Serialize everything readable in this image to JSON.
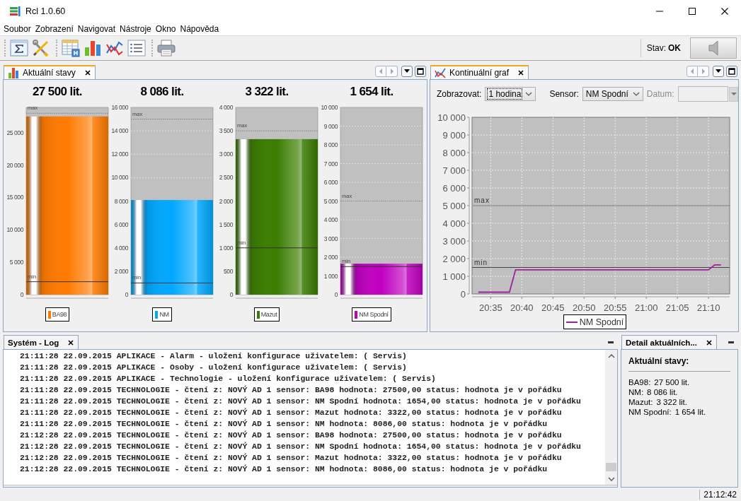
{
  "window": {
    "title": "Rcl 1.0.60"
  },
  "menu": [
    "Soubor",
    "Zobrazení",
    "Navigovat",
    "Nástroje",
    "Okno",
    "Nápověda"
  ],
  "toolbar": {
    "status": "Stav: **OK**"
  },
  "panels": {
    "current_states": {
      "tab": "Aktuální stavy",
      "gauges": [
        {
          "chart_data": {
            "type": "bar",
            "title": "27 500 lit.",
            "ylim": [
              0,
              28900
            ],
            "yticks": [
              {
                "value": 0,
                "label": "0"
              },
              {
                "value": 5000,
                "label": "5 000"
              },
              {
                "value": 10000,
                "label": "10 000"
              },
              {
                "value": 15000,
                "label": "15 000"
              },
              {
                "value": 20000,
                "label": "20 000"
              },
              {
                "value": 25000,
                "label": "25 000"
              }
            ],
            "series": [
              {
                "name": "BA98",
                "color": "#ff7a00",
                "values": [
                  27500
                ]
              }
            ],
            "ref_lines": [
              {
                "axis": "y",
                "value": 28000,
                "label": "max"
              },
              {
                "axis": "y",
                "value": 2000,
                "label": "min"
              }
            ]
          }
        },
        {
          "chart_data": {
            "type": "bar",
            "title": "8 086 lit.",
            "grid": true,
            "ylim": [
              0,
              16000
            ],
            "yticks": [
              {
                "value": 0,
                "label": "0"
              },
              {
                "value": 2000,
                "label": "2 000"
              },
              {
                "value": 4000,
                "label": "4 000"
              },
              {
                "value": 6000,
                "label": "6 000"
              },
              {
                "value": 8000,
                "label": "8 000"
              },
              {
                "value": 10000,
                "label": "10 000"
              },
              {
                "value": 12000,
                "label": "12 000"
              },
              {
                "value": 14000,
                "label": "14 000"
              },
              {
                "value": 16000,
                "label": "16 000"
              }
            ],
            "series": [
              {
                "name": "NM",
                "color": "#00a8ff",
                "values": [
                  8086
                ]
              }
            ],
            "ref_lines": [
              {
                "axis": "y",
                "value": 15000,
                "label": "max"
              },
              {
                "axis": "y",
                "value": 1000,
                "label": "min"
              }
            ]
          }
        },
        {
          "chart_data": {
            "type": "bar",
            "title": "3 322 lit.",
            "ylim": [
              0,
              4000
            ],
            "yticks": [
              {
                "value": 0,
                "label": "0"
              },
              {
                "value": 500,
                "label": "500"
              },
              {
                "value": 1000,
                "label": "1 000"
              },
              {
                "value": 1500,
                "label": "1 500"
              },
              {
                "value": 2000,
                "label": "2 000"
              },
              {
                "value": 2500,
                "label": "2 500"
              },
              {
                "value": 3000,
                "label": "3 000"
              },
              {
                "value": 3500,
                "label": "3 500"
              },
              {
                "value": 4000,
                "label": "4 000"
              }
            ],
            "series": [
              {
                "name": "Mazut",
                "color": "#3a7d00",
                "values": [
                  3322
                ]
              }
            ],
            "ref_lines": [
              {
                "axis": "y",
                "value": 3500,
                "label": "max"
              },
              {
                "axis": "y",
                "value": 1000,
                "label": "min"
              }
            ]
          }
        },
        {
          "chart_data": {
            "type": "bar",
            "title": "1 654 lit.",
            "grid": true,
            "ylim": [
              0,
              10000
            ],
            "yticks": [
              {
                "value": 0,
                "label": "0"
              },
              {
                "value": 1000,
                "label": "1 000"
              },
              {
                "value": 2000,
                "label": "2 000"
              },
              {
                "value": 3000,
                "label": "3 000"
              },
              {
                "value": 4000,
                "label": "4 000"
              },
              {
                "value": 5000,
                "label": "5 000"
              },
              {
                "value": 6000,
                "label": "6 000"
              },
              {
                "value": 7000,
                "label": "7 000"
              },
              {
                "value": 8000,
                "label": "8 000"
              },
              {
                "value": 9000,
                "label": "9 000"
              },
              {
                "value": 10000,
                "label": "10 000"
              }
            ],
            "series": [
              {
                "name": "NM Spodní",
                "color": "#c000c0",
                "values": [
                  1654
                ]
              }
            ],
            "ref_lines": [
              {
                "axis": "y",
                "value": 5000,
                "label": "max"
              },
              {
                "axis": "y",
                "value": 1500,
                "label": "min"
              }
            ]
          }
        }
      ]
    },
    "continuous_graph": {
      "tab": "Kontinuální graf",
      "filters": [
        {
          "kind": "combo",
          "label": "Zobrazovat:",
          "value": "1 hodina",
          "focused": true,
          "disabled": false
        },
        {
          "kind": "combo",
          "label": "Sensor:",
          "value": "NM Spodní",
          "focused": false,
          "disabled": false
        },
        {
          "kind": "date",
          "label": "Datum:",
          "focused": false,
          "disabled": true
        }
      ],
      "chart_data": {
        "type": "line",
        "grid": true,
        "ylim": [
          0,
          10000
        ],
        "categories": [
          null,
          null,
          "20:35",
          null,
          null,
          null,
          null,
          "20:40",
          null,
          null,
          null,
          null,
          "20:45",
          null,
          null,
          null,
          null,
          "20:50",
          null,
          null,
          null,
          null,
          "20:55",
          null,
          null,
          null,
          null,
          "21:00",
          null,
          null,
          null,
          null,
          "21:05",
          null,
          null,
          null,
          null,
          "21:10",
          null,
          null
        ],
        "yticks": [
          {
            "value": 0,
            "label": "0"
          },
          {
            "value": 1000,
            "label": "1 000"
          },
          {
            "value": 2000,
            "label": "2 000"
          },
          {
            "value": 3000,
            "label": "3 000"
          },
          {
            "value": 4000,
            "label": "4 000"
          },
          {
            "value": 5000,
            "label": "5 000"
          },
          {
            "value": 6000,
            "label": "6 000"
          },
          {
            "value": 7000,
            "label": "7 000"
          },
          {
            "value": 8000,
            "label": "8 000"
          },
          {
            "value": 9000,
            "label": "9 000"
          },
          {
            "value": 10000,
            "label": "10 000"
          }
        ],
        "series": [
          {
            "name": "NM Spodní",
            "color": "#a020a0",
            "values": [
              100,
              100,
              100,
              100,
              100,
              100,
              1370,
              1370,
              1370,
              1370,
              1370,
              1370,
              1370,
              1370,
              1370,
              1370,
              1370,
              1370,
              1370,
              1370,
              1370,
              1370,
              1370,
              1370,
              1370,
              1370,
              1370,
              1370,
              1370,
              1370,
              1370,
              1370,
              1370,
              1370,
              1370,
              1370,
              1370,
              1370,
              1650,
              1650
            ]
          }
        ],
        "ref_lines": [
          {
            "axis": "y",
            "value": 5000,
            "label": "max"
          },
          {
            "axis": "y",
            "value": 1500,
            "label": "min"
          }
        ]
      }
    },
    "log": {
      "tab": "Systém - Log",
      "lines": [
        "21:11:28 22.09.2015 APLIKACE - Alarm - uložení konfigurace uživatelem: ( Servis)",
        "21:11:28 22.09.2015 APLIKACE - Osoby - uložení konfigurace uživatelem: ( Servis)",
        "21:11:28 22.09.2015 APLIKACE - Technologie - uložení konfigurace uživatelem: ( Servis)",
        "21:11:28 22.09.2015 TECHNOLOGIE - čtení z: NOVÝ AD 1 sensor: BA98 hodnota: 27500,00 status: hodnota je v pořádku",
        "21:11:28 22.09.2015 TECHNOLOGIE - čtení z: NOVÝ AD 1 sensor: NM Spodní hodnota: 1654,00 status: hodnota je v pořádku",
        "21:11:28 22.09.2015 TECHNOLOGIE - čtení z: NOVÝ AD 1 sensor: Mazut hodnota: 3322,00 status: hodnota je v pořádku",
        "21:11:28 22.09.2015 TECHNOLOGIE - čtení z: NOVÝ AD 1 sensor: NM hodnota: 8086,00 status: hodnota je v pořádku",
        "21:12:28 22.09.2015 TECHNOLOGIE - čtení z: NOVÝ AD 1 sensor: BA98 hodnota: 27500,00 status: hodnota je v pořádku",
        "21:12:28 22.09.2015 TECHNOLOGIE - čtení z: NOVÝ AD 1 sensor: NM Spodní hodnota: 1654,00 status: hodnota je v pořádku",
        "21:12:28 22.09.2015 TECHNOLOGIE - čtení z: NOVÝ AD 1 sensor: Mazut hodnota: 3322,00 status: hodnota je v pořádku",
        "21:12:28 22.09.2015 TECHNOLOGIE - čtení z: NOVÝ AD 1 sensor: NM hodnota: 8086,00 status: hodnota je v pořádku"
      ]
    },
    "detail": {
      "tab": "Detail aktuálních...",
      "heading": "Aktuální stavy:",
      "rows": [
        {
          "label": "BA98:",
          "value": "27 500 lit."
        },
        {
          "label": "NM:",
          "value": "8 086 lit."
        },
        {
          "label": "Mazut:",
          "value": "3 322 lit."
        },
        {
          "label": "NM Spodní:",
          "value": "1 654 lit."
        }
      ]
    }
  },
  "status_bar": {
    "time": "21:12:42"
  }
}
